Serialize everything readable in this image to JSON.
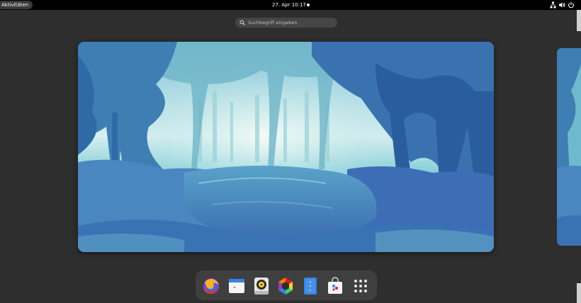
{
  "topbar": {
    "activities_label": "Aktivitäten",
    "clock": "27. Apr 10:17",
    "tray_icons": [
      "network-icon",
      "volume-icon",
      "power-icon"
    ]
  },
  "search": {
    "placeholder": "Suchbegriff eingeben"
  },
  "dock": {
    "apps": [
      {
        "name": "Firefox",
        "icon": "firefox-icon"
      },
      {
        "name": "Calendar",
        "icon": "calendar-icon"
      },
      {
        "name": "Rhythmbox",
        "icon": "rhythmbox-icon"
      },
      {
        "name": "Software",
        "icon": "software-icon"
      },
      {
        "name": "Text Editor",
        "icon": "text-editor-icon"
      },
      {
        "name": "Software Center",
        "icon": "software-center-icon"
      },
      {
        "name": "Show Applications",
        "icon": "app-grid-icon"
      }
    ]
  },
  "colors": {
    "topbar": "#000000",
    "background": "#2e2e2e",
    "dock": "#3f3f3f",
    "search": "#464646"
  }
}
